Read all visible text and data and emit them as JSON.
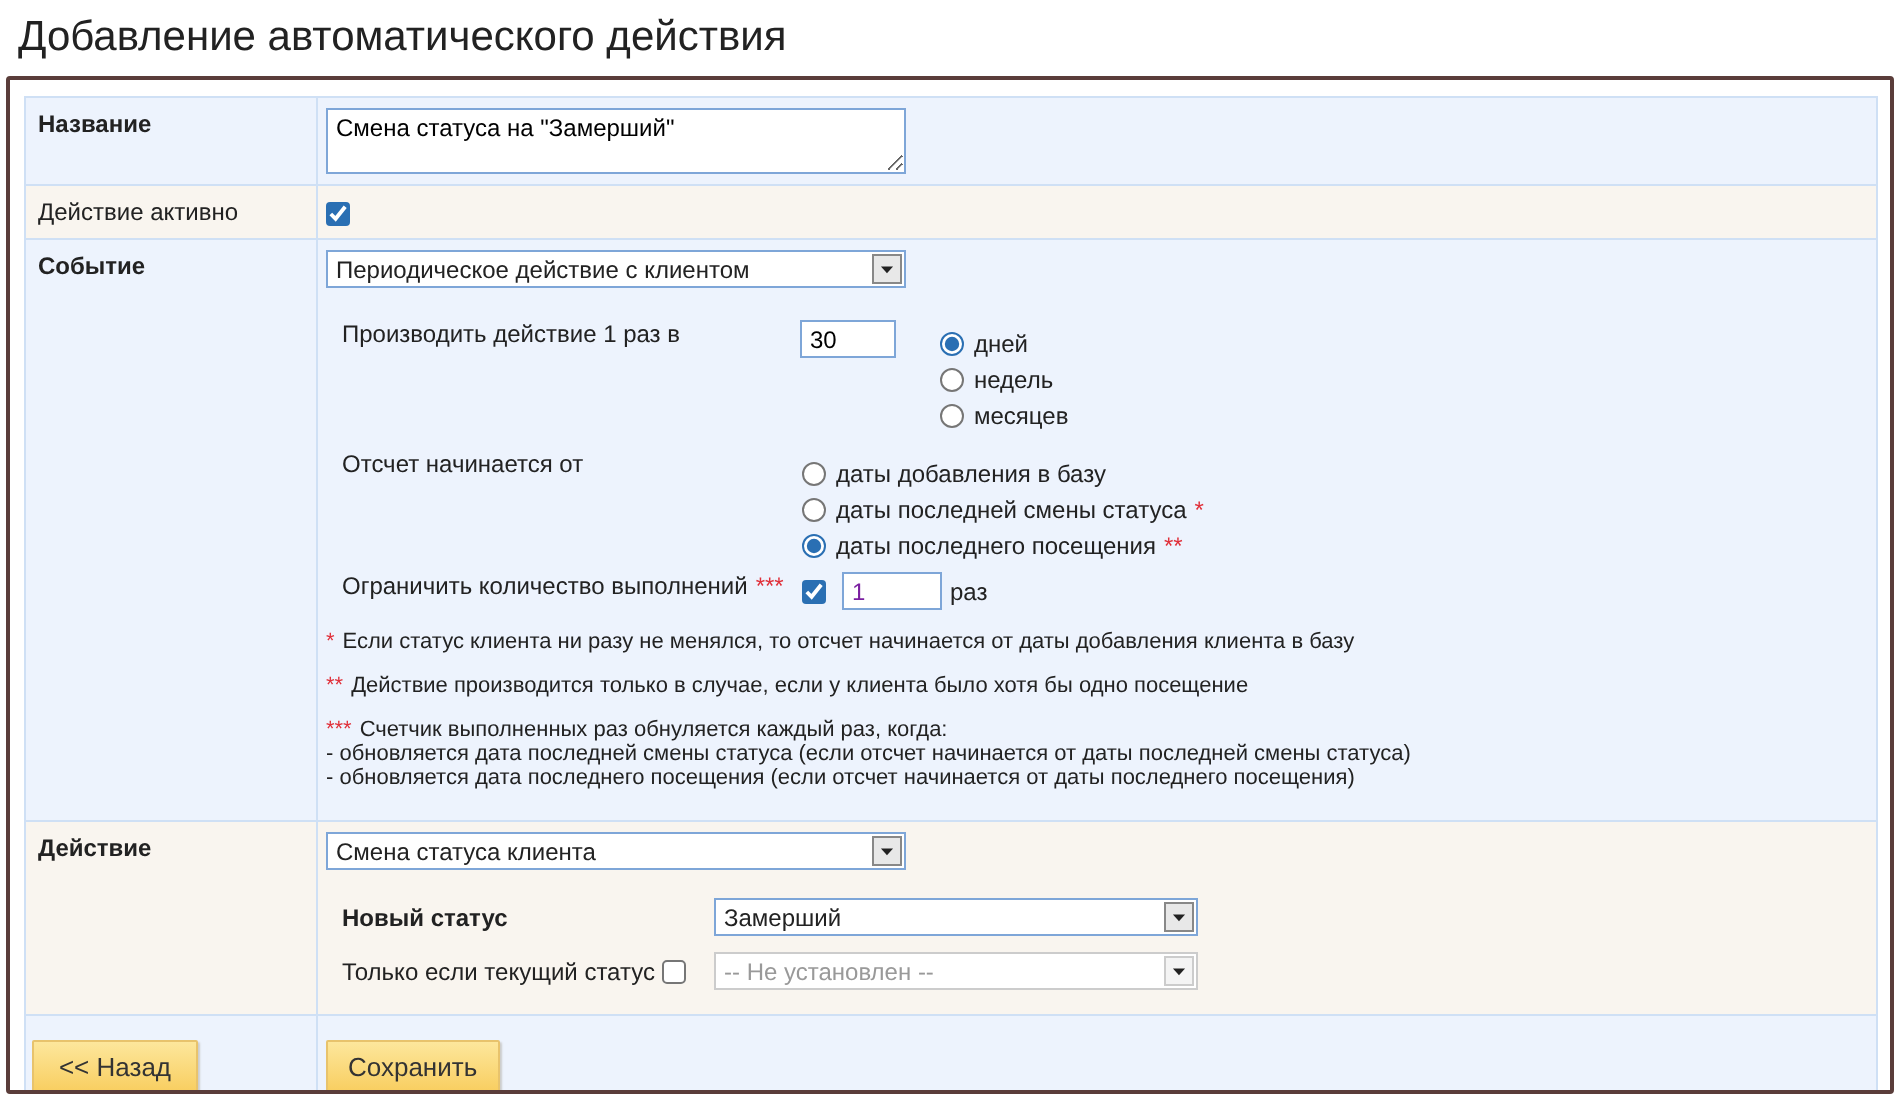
{
  "title": "Добавление автоматического действия",
  "name_field": {
    "label": "Название",
    "value": "Смена статуса на \"Замерший\""
  },
  "active": {
    "label": "Действие активно",
    "checked": true
  },
  "event": {
    "label": "Событие",
    "select": "Периодическое действие с клиентом",
    "frequency": {
      "label": "Производить действие 1 раз в",
      "value": "30",
      "units": [
        {
          "label": "дней",
          "selected": true
        },
        {
          "label": "недель",
          "selected": false
        },
        {
          "label": "месяцев",
          "selected": false
        }
      ]
    },
    "start": {
      "label": "Отсчет начинается от",
      "options": [
        {
          "label": "даты добавления в базу",
          "selected": false
        },
        {
          "label": "даты последней смены статуса",
          "mark": "*",
          "selected": false
        },
        {
          "label": "даты последнего посещения",
          "mark": "**",
          "selected": true
        }
      ]
    },
    "limit": {
      "label": "Ограничить количество выполнений",
      "mark": "***",
      "checked": true,
      "value": "1",
      "unit": "раз"
    },
    "notes": [
      {
        "mark": "*",
        "lines": [
          "Если статус клиента ни разу не менялся, то отсчет начинается от даты добавления клиента в базу"
        ]
      },
      {
        "mark": "**",
        "lines": [
          "Действие производится только в случае, если у клиента было хотя бы одно посещение"
        ]
      },
      {
        "mark": "***",
        "lines": [
          "Счетчик выполненных раз обнуляется каждый раз, когда:",
          "- обновляется дата последней смены статуса (если отсчет начинается от даты последней смены статуса)",
          "- обновляется дата последнего посещения (если отсчет начинается от даты последнего посещения)"
        ]
      }
    ]
  },
  "action": {
    "label": "Действие",
    "select": "Смена статуса клиента",
    "new_status": {
      "label": "Новый статус",
      "value": "Замерший"
    },
    "only_if": {
      "label": "Только если текущий статус",
      "checked": false,
      "value": "-- Не установлен --",
      "disabled": true
    }
  },
  "buttons": [
    {
      "label": "<< Назад"
    },
    {
      "label": "Сохранить"
    }
  ]
}
